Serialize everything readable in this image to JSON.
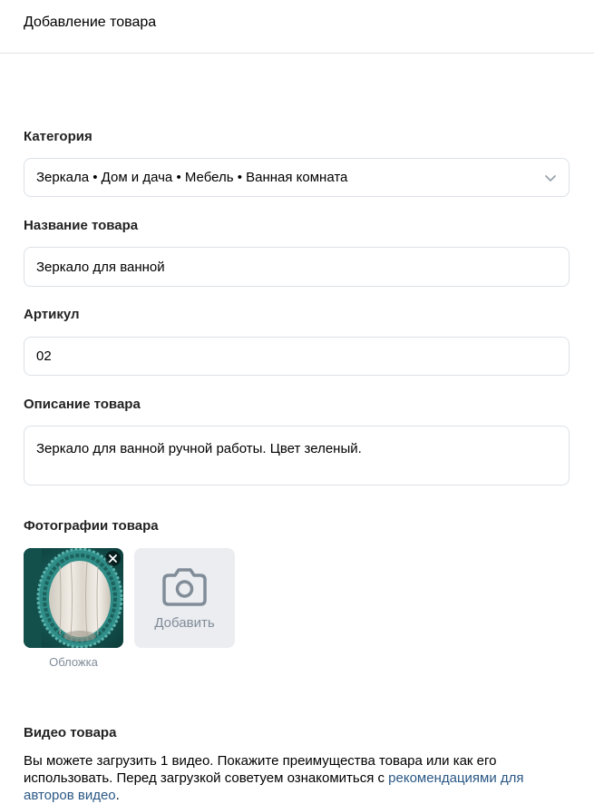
{
  "header": {
    "title": "Добавление товара"
  },
  "category": {
    "label": "Категория",
    "value": "Зеркала • Дом и дача • Мебель • Ванная комната",
    "chevron_icon": "chevron-down-icon"
  },
  "name": {
    "label": "Название товара",
    "value": "Зеркало для ванной"
  },
  "sku": {
    "label": "Артикул",
    "value": "02"
  },
  "description": {
    "label": "Описание товара",
    "value": "Зеркало для ванной ручной работы. Цвет зеленый."
  },
  "photos": {
    "label": "Фотографии товара",
    "cover_label": "Обложка",
    "add_label": "Добавить",
    "remove_icon": "close-icon",
    "add_icon": "camera-icon"
  },
  "video": {
    "label": "Видео товара",
    "text_before": "Вы можете загрузить 1 видео. Покажите преимущества товара или как его использовать. Перед загрузкой советуем ознакомиться с ",
    "link_text": "рекомендациями для авторов видео",
    "text_after": "."
  },
  "colors": {
    "link": "#2a5885",
    "border": "#dce1e6",
    "muted": "#818c99"
  }
}
